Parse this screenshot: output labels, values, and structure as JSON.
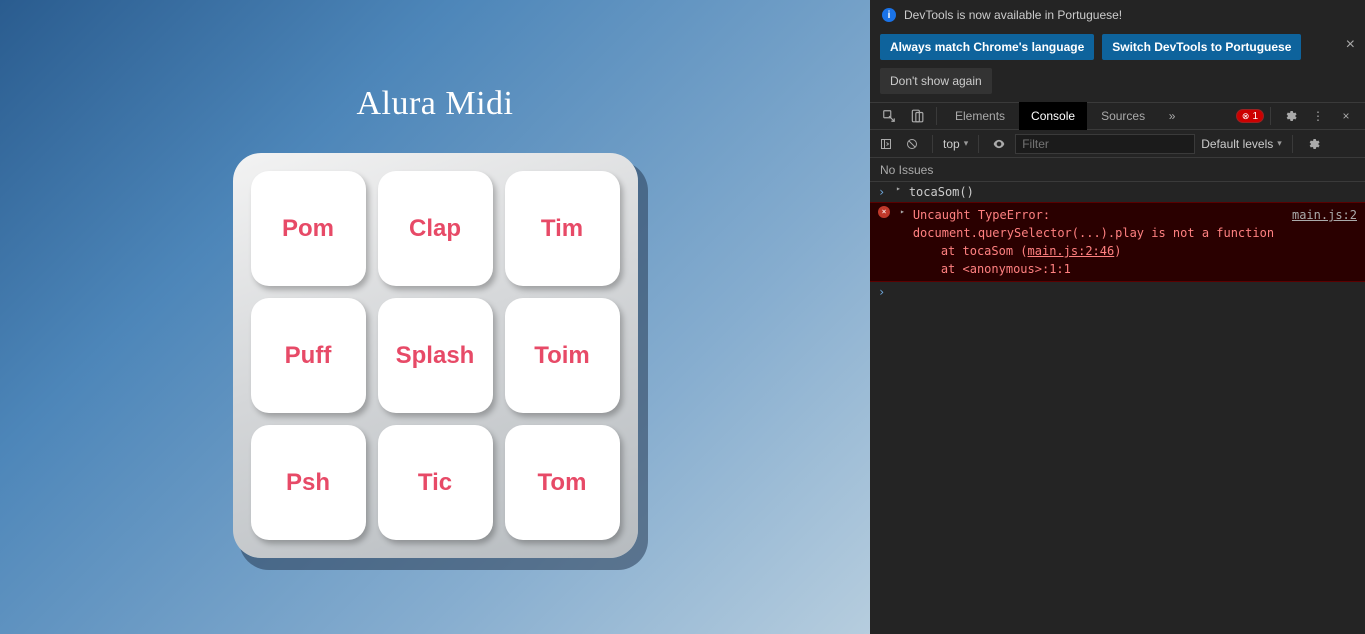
{
  "app": {
    "title": "Alura Midi",
    "pads": [
      "Pom",
      "Clap",
      "Tim",
      "Puff",
      "Splash",
      "Toim",
      "Psh",
      "Tic",
      "Tom"
    ]
  },
  "notice": {
    "text": "DevTools is now available in Portuguese!",
    "btn_match": "Always match Chrome's language",
    "btn_switch": "Switch DevTools to Portuguese",
    "btn_dontshow": "Don't show again"
  },
  "tabs": {
    "elements": "Elements",
    "console": "Console",
    "sources": "Sources"
  },
  "toolbar": {
    "error_count": "1"
  },
  "subbar": {
    "top": "top",
    "filter_placeholder": "Filter",
    "levels": "Default levels"
  },
  "issues": {
    "label": "No Issues"
  },
  "console": {
    "input1": "tocaSom()",
    "error_main": "Uncaught TypeError: document.querySelector(...).play is not a function",
    "error_source": "main.js:2",
    "stack1_prefix": "at tocaSom (",
    "stack1_link": "main.js:2:46",
    "stack1_suffix": ")",
    "stack2": "at <anonymous>:1:1"
  }
}
